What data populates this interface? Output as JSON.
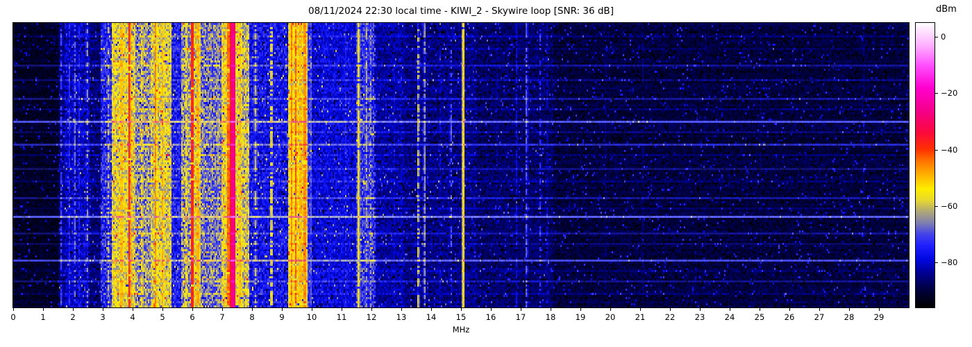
{
  "title": "08/11/2024 22:30 local time - KIWI_2 - Skywire loop [SNR: 36 dB]",
  "xlabel": "MHz",
  "colorbar": {
    "label": "dBm",
    "tick_labels": [
      "0",
      "−20",
      "−40",
      "−60",
      "−80"
    ],
    "tick_values": [
      0,
      -20,
      -40,
      -60,
      -80
    ]
  },
  "x_axis": {
    "tick_labels": [
      "0",
      "1",
      "2",
      "3",
      "4",
      "5",
      "6",
      "7",
      "8",
      "9",
      "10",
      "11",
      "12",
      "13",
      "14",
      "15",
      "16",
      "17",
      "18",
      "19",
      "20",
      "21",
      "22",
      "23",
      "24",
      "25",
      "26",
      "27",
      "28",
      "29"
    ],
    "tick_values": [
      0,
      1,
      2,
      3,
      4,
      5,
      6,
      7,
      8,
      9,
      10,
      11,
      12,
      13,
      14,
      15,
      16,
      17,
      18,
      19,
      20,
      21,
      22,
      23,
      24,
      25,
      26,
      27,
      28,
      29
    ]
  },
  "chart_data": {
    "type": "heatmap",
    "title": "08/11/2024 22:30 local time - KIWI_2 - Skywire loop [SNR: 36 dB]",
    "xlabel": "MHz",
    "x_range": [
      0,
      30
    ],
    "value_unit": "dBm",
    "value_range": [
      -96,
      5
    ],
    "colorbar_ticks": [
      0,
      -20,
      -40,
      -60,
      -80
    ],
    "grid": false,
    "legend": "colorbar right",
    "bins": 645,
    "rows": 137,
    "seed": 1234,
    "colormap_stops": [
      [
        -96,
        "#000000"
      ],
      [
        -90,
        "#00003c"
      ],
      [
        -84,
        "#000090"
      ],
      [
        -79,
        "#0008e0"
      ],
      [
        -74,
        "#2020ff"
      ],
      [
        -70,
        "#4545e8"
      ],
      [
        -66,
        "#8080b0"
      ],
      [
        -62,
        "#b0a878"
      ],
      [
        -58,
        "#e8d830"
      ],
      [
        -54,
        "#ffee00"
      ],
      [
        -49,
        "#ffb300"
      ],
      [
        -44,
        "#ff7400"
      ],
      [
        -40,
        "#ff3300"
      ],
      [
        -34,
        "#fb0a3c"
      ],
      [
        -26,
        "#f5008c"
      ],
      [
        -18,
        "#ff00d0"
      ],
      [
        -10,
        "#ff50ff"
      ],
      [
        -3,
        "#ffb0ff"
      ],
      [
        5,
        "#ffffff"
      ]
    ],
    "noise_floor_bands_mhz_dbm": [
      [
        0.0,
        1.52,
        -92,
        2.5
      ],
      [
        1.52,
        1.72,
        -85,
        4
      ],
      [
        1.72,
        2.58,
        -81,
        5
      ],
      [
        2.58,
        2.95,
        -86,
        4
      ],
      [
        2.95,
        3.32,
        -74,
        7
      ],
      [
        3.32,
        4.08,
        -58,
        7
      ],
      [
        4.08,
        4.6,
        -65,
        8
      ],
      [
        4.6,
        5.32,
        -59,
        7
      ],
      [
        5.32,
        5.62,
        -75,
        6
      ],
      [
        5.62,
        5.98,
        -64,
        8
      ],
      [
        5.98,
        6.28,
        -57,
        7
      ],
      [
        6.28,
        6.98,
        -67,
        8
      ],
      [
        6.98,
        7.58,
        -57,
        7
      ],
      [
        7.58,
        7.9,
        -61,
        7
      ],
      [
        7.9,
        9.22,
        -77,
        6
      ],
      [
        9.22,
        9.88,
        -56,
        7
      ],
      [
        9.88,
        10.02,
        -73,
        5
      ],
      [
        10.02,
        11.48,
        -79,
        4.5
      ],
      [
        11.48,
        11.65,
        -71,
        6
      ],
      [
        11.65,
        12.08,
        -73,
        7
      ],
      [
        12.08,
        13.12,
        -83,
        4
      ],
      [
        13.12,
        15.55,
        -85,
        4
      ],
      [
        15.55,
        18.1,
        -87,
        3.5
      ],
      [
        18.1,
        30.0,
        -90,
        3
      ]
    ],
    "carriers_mhz_width_dbm_dash": [
      [
        1.62,
        0.05,
        -71,
        0.35
      ],
      [
        1.87,
        0.05,
        -73,
        0.45
      ],
      [
        2.06,
        0.05,
        -68,
        0.4
      ],
      [
        2.22,
        0.05,
        -74,
        0.5
      ],
      [
        2.47,
        0.05,
        -64,
        0.55
      ],
      [
        3.2,
        0.05,
        -61,
        0.5
      ],
      [
        3.64,
        0.08,
        -50,
        0.25
      ],
      [
        3.9,
        0.06,
        -38,
        0.04
      ],
      [
        4.32,
        0.05,
        -53,
        0.35
      ],
      [
        4.78,
        0.06,
        -46,
        0.2
      ],
      [
        5.01,
        0.05,
        -49,
        0.3
      ],
      [
        5.8,
        0.05,
        -55,
        0.4
      ],
      [
        6.0,
        0.06,
        -38,
        0.04
      ],
      [
        6.18,
        0.06,
        -49,
        0.25
      ],
      [
        6.62,
        0.04,
        -67,
        0.45
      ],
      [
        6.85,
        0.04,
        -64,
        0.4
      ],
      [
        7.21,
        0.06,
        -44,
        0.12
      ],
      [
        7.36,
        0.13,
        -27,
        0.0
      ],
      [
        7.62,
        0.06,
        -50,
        0.2
      ],
      [
        8.12,
        0.05,
        -61,
        0.5
      ],
      [
        8.65,
        0.05,
        -59,
        0.5
      ],
      [
        9.33,
        0.06,
        -45,
        0.12
      ],
      [
        9.48,
        0.06,
        -43,
        0.1
      ],
      [
        9.63,
        0.06,
        -50,
        0.2
      ],
      [
        9.77,
        0.06,
        -46,
        0.15
      ],
      [
        9.96,
        0.04,
        -69,
        0.4
      ],
      [
        10.56,
        0.04,
        -75,
        0.5
      ],
      [
        11.12,
        0.04,
        -74,
        0.5
      ],
      [
        11.57,
        0.05,
        -55,
        0.12
      ],
      [
        11.82,
        0.05,
        -63,
        0.45
      ],
      [
        11.97,
        0.05,
        -64,
        0.5
      ],
      [
        12.12,
        0.04,
        -71,
        0.55
      ],
      [
        12.78,
        0.04,
        -80,
        0.4
      ],
      [
        13.02,
        0.04,
        -79,
        0.5
      ],
      [
        13.57,
        0.04,
        -59,
        0.5
      ],
      [
        13.78,
        0.04,
        -64,
        0.25
      ],
      [
        14.32,
        0.04,
        -80,
        0.5
      ],
      [
        14.66,
        0.04,
        -69,
        0.65
      ],
      [
        15.08,
        0.05,
        -53,
        0.02
      ],
      [
        16.22,
        0.04,
        -83,
        0.45
      ],
      [
        16.87,
        0.04,
        -79,
        0.3
      ],
      [
        17.2,
        0.05,
        -69,
        0.3
      ],
      [
        17.66,
        0.04,
        -73,
        0.5
      ],
      [
        17.9,
        0.04,
        -80,
        0.5
      ],
      [
        19.82,
        0.035,
        -86,
        0.5
      ],
      [
        21.1,
        0.035,
        -85,
        0.45
      ],
      [
        23.2,
        0.03,
        -88,
        0.5
      ],
      [
        25.05,
        0.03,
        -87,
        0.5
      ],
      [
        28.5,
        0.035,
        -86,
        0.45
      ]
    ],
    "static_burst_rows_boost_blend": [
      [
        6,
        3,
        0
      ],
      [
        12,
        3,
        0
      ],
      [
        20,
        5,
        0.08
      ],
      [
        27,
        4,
        0.04
      ],
      [
        36,
        6,
        0.1
      ],
      [
        41,
        3,
        0
      ],
      [
        47,
        12,
        0.35
      ],
      [
        52,
        4,
        0.04
      ],
      [
        58,
        8,
        0.18
      ],
      [
        63,
        3,
        0
      ],
      [
        70,
        5,
        0.08
      ],
      [
        76,
        3,
        0
      ],
      [
        84,
        6,
        0.1
      ],
      [
        89,
        3,
        0
      ],
      [
        93,
        13,
        0.4
      ],
      [
        101,
        5,
        0.08
      ],
      [
        106,
        4,
        0.04
      ],
      [
        114,
        11,
        0.3
      ],
      [
        119,
        3,
        0
      ],
      [
        124,
        5,
        0.08
      ],
      [
        130,
        3,
        0
      ],
      [
        134,
        3,
        0
      ]
    ]
  }
}
